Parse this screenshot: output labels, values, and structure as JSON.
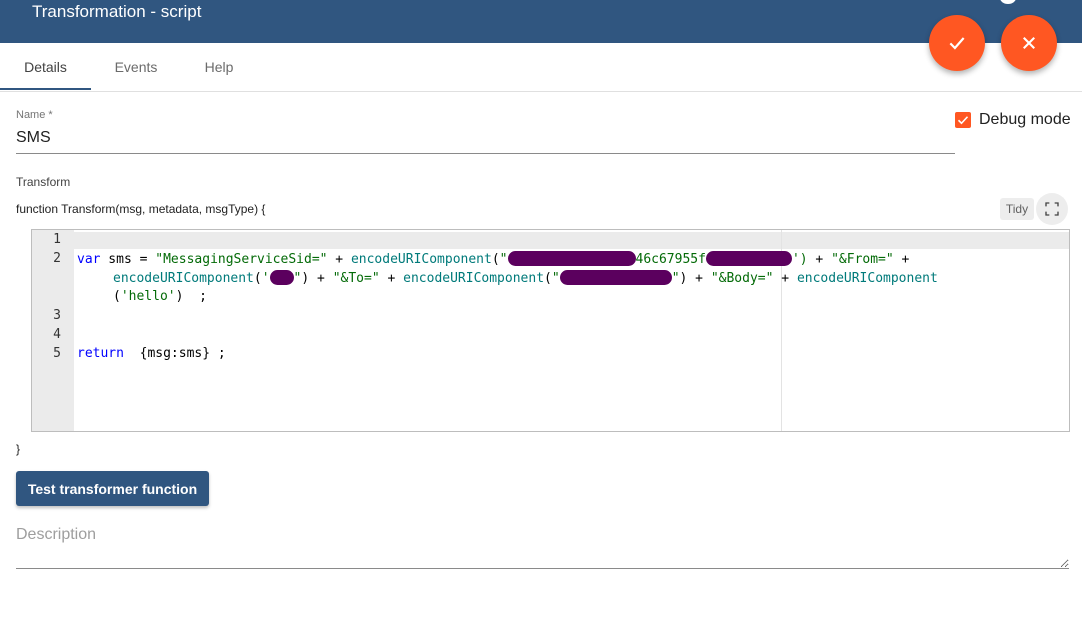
{
  "header": {
    "title": "Transformation - script"
  },
  "actions": {
    "apply_icon": "check-icon",
    "close_icon": "close-icon"
  },
  "tabs": [
    {
      "label": "Details",
      "active": true
    },
    {
      "label": "Events",
      "active": false
    },
    {
      "label": "Help",
      "active": false
    }
  ],
  "form": {
    "name_label": "Name *",
    "name_value": "SMS",
    "debug_label": "Debug mode",
    "debug_checked": true,
    "transform_label": "Transform",
    "function_signature": "function Transform(msg, metadata, msgType) {",
    "tidy_label": "Tidy",
    "closing_brace": "}",
    "test_button": "Test transformer function",
    "description_placeholder": "Description"
  },
  "editor": {
    "line_numbers": [
      "1",
      "2",
      "3",
      "4",
      "5"
    ],
    "line2a": {
      "kw": "var",
      "p1": " sms = ",
      "s1": "\"MessagingServiceSid=\"",
      "p2": " + ",
      "f1": "encodeURIComponent",
      "p3": "(",
      "s2": "\"",
      "s3": "46c67955f",
      "s4": "')",
      "p4": " + ",
      "s5": "\"&From=\"",
      "p5": " +"
    },
    "line2b": {
      "f1": "encodeURIComponent",
      "p1": "(",
      "s1": "'",
      "s2": "\"",
      "p2": ") + ",
      "s3": "\"&To=\"",
      "p3": " + ",
      "f2": "encodeURIComponent",
      "p4": "(",
      "s4": "\"",
      "s5": "\"",
      "p5": ") + ",
      "s6": "\"&Body=\"",
      "p6": " + ",
      "f3": "encodeURIComponent"
    },
    "line2c": {
      "p1": "(",
      "s1": "'hello'",
      "p2": ")  ;"
    },
    "line5": {
      "kw": "return",
      "p1": "  {msg:sms} ;"
    }
  },
  "colors": {
    "header": "#305680",
    "accent": "#ff5722",
    "redaction": "#5b005e"
  }
}
